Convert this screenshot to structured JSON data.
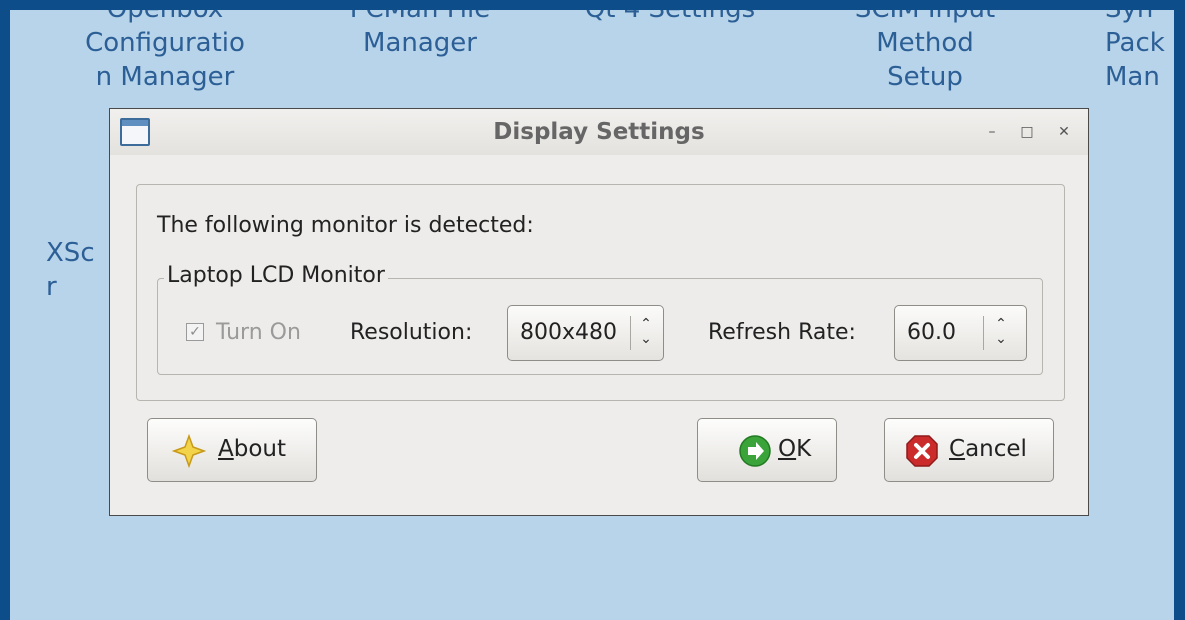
{
  "desktop": {
    "icons": [
      {
        "label": "Openbox\nConfiguratio\nn Manager"
      },
      {
        "label": "PCMan File\nManager"
      },
      {
        "label": "Qt 4 Settings"
      },
      {
        "label": "SCIM Input\nMethod\nSetup"
      },
      {
        "label": "Syn\nPack\nMan"
      },
      {
        "label": "XSc\nr"
      }
    ]
  },
  "window": {
    "title": "Display Settings",
    "detected_text": "The following monitor is detected:",
    "monitor_frame_label": "Laptop LCD Monitor",
    "turn_on": {
      "label": "Turn On",
      "checked": true,
      "enabled": false
    },
    "resolution": {
      "label": "Resolution:",
      "value": "800x480"
    },
    "refresh_rate": {
      "label": "Refresh Rate:",
      "value": "60.0"
    },
    "buttons": {
      "about": {
        "label": "About",
        "mnemonic": "A"
      },
      "ok": {
        "label": "OK",
        "mnemonic": "O"
      },
      "cancel": {
        "label": "Cancel",
        "mnemonic": "C"
      }
    }
  },
  "colors": {
    "desktop_border": "#0d4d8a",
    "desktop_bg": "#b8d4ea",
    "icon_text": "#2c5f96",
    "ok_green": "#3aa33a",
    "cancel_red": "#cc2b2b",
    "about_star": "#f3d34a"
  },
  "icons": {
    "window": "window-icon",
    "about": "star-icon",
    "ok": "ok-arrow-icon",
    "cancel": "cancel-x-icon"
  }
}
